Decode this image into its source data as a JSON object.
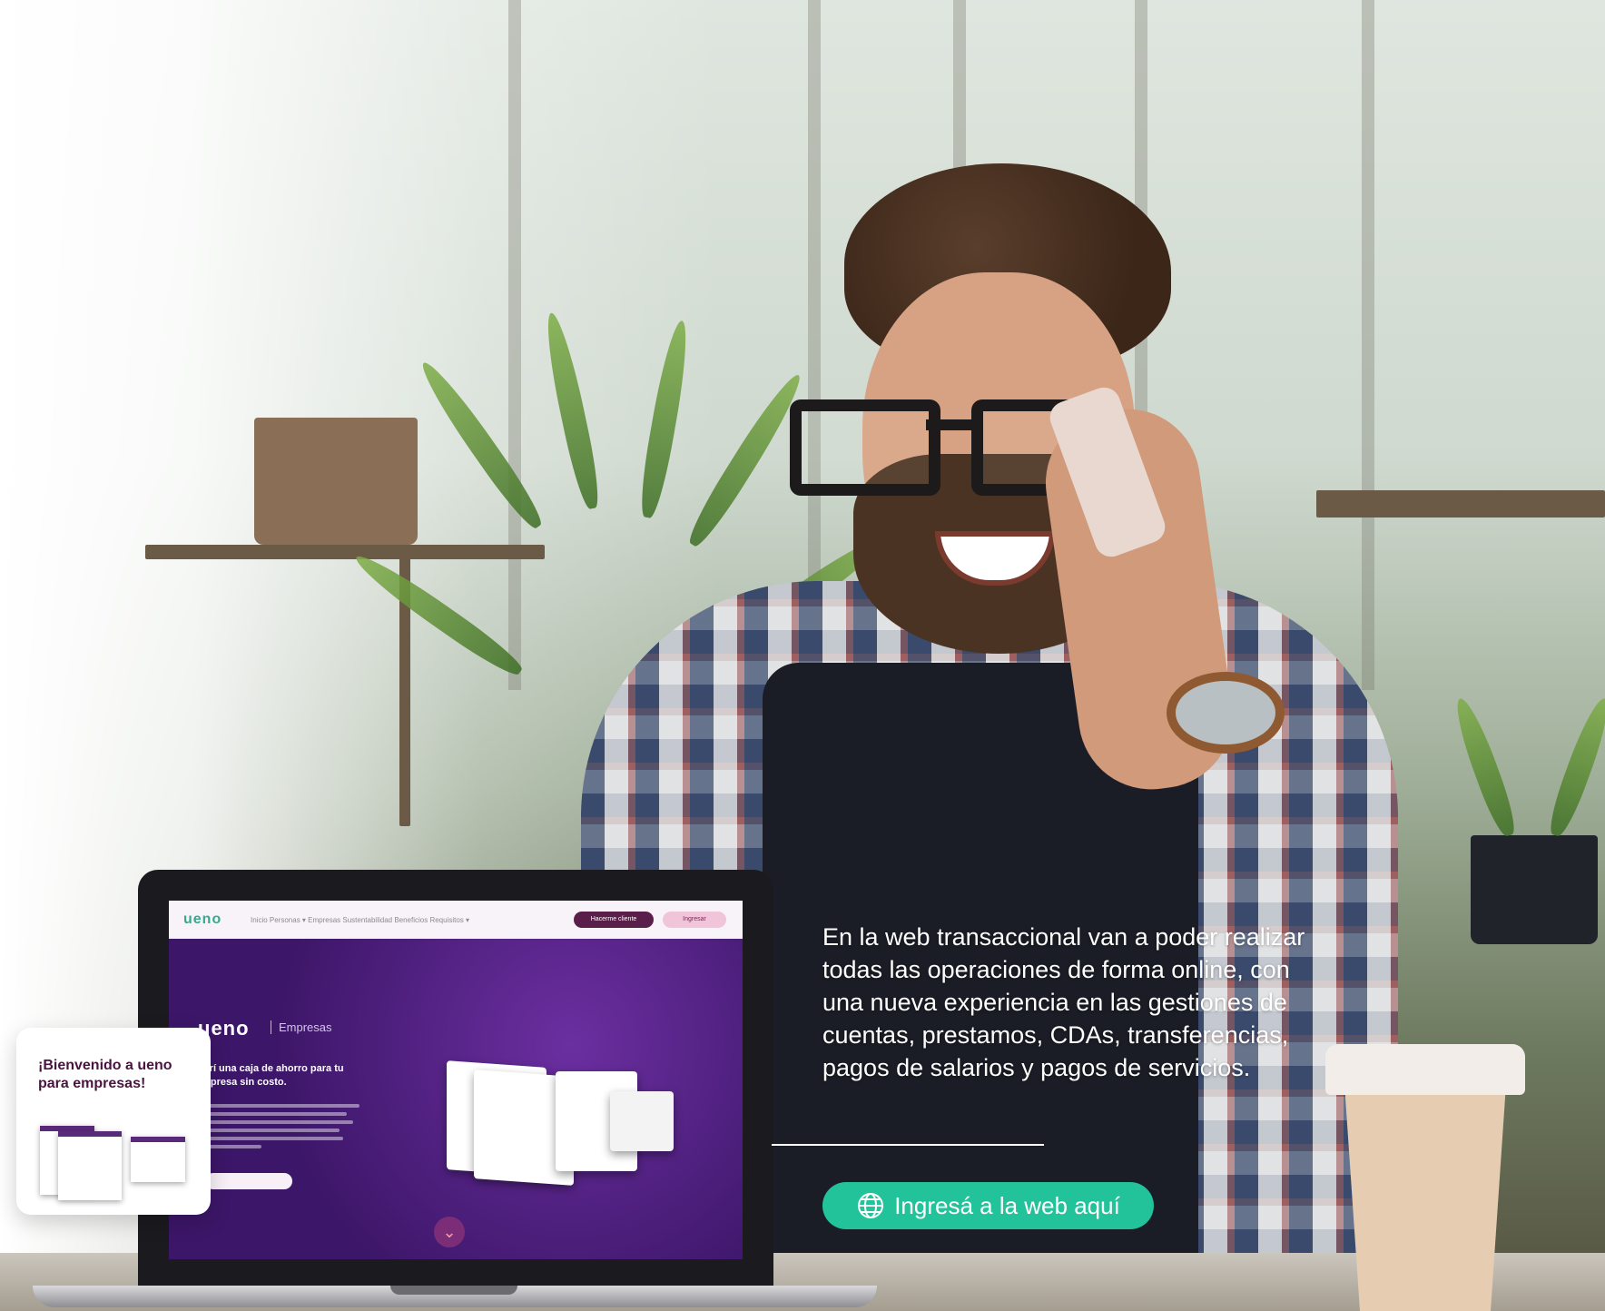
{
  "hero": {
    "description": "En la web transaccional van a poder realizar todas las operaciones de forma online, con una nueva experiencia en las gestiones de cuentas, prestamos, CDAs, transferencias, pagos de salarios y pagos de servicios.",
    "cta_label": "Ingresá a la web aquí",
    "cta_icon": "globe-icon",
    "accent_color": "#22c39a"
  },
  "laptop_screen": {
    "logo": "ueno",
    "nav_links": "Inicio   Personas ▾   Empresas   Sustentabilidad   Beneficios   Requisitos ▾",
    "primary_button": "Hacerme cliente",
    "secondary_button": "Ingresar",
    "brand": "ueno",
    "brand_sub": "Empresas",
    "headline": "Abrí una caja de ahorro para tu empresa sin costo.",
    "scroll_icon": "arrow-down-icon"
  },
  "popup": {
    "title": "¡Bienvenido a ueno para empresas!"
  }
}
